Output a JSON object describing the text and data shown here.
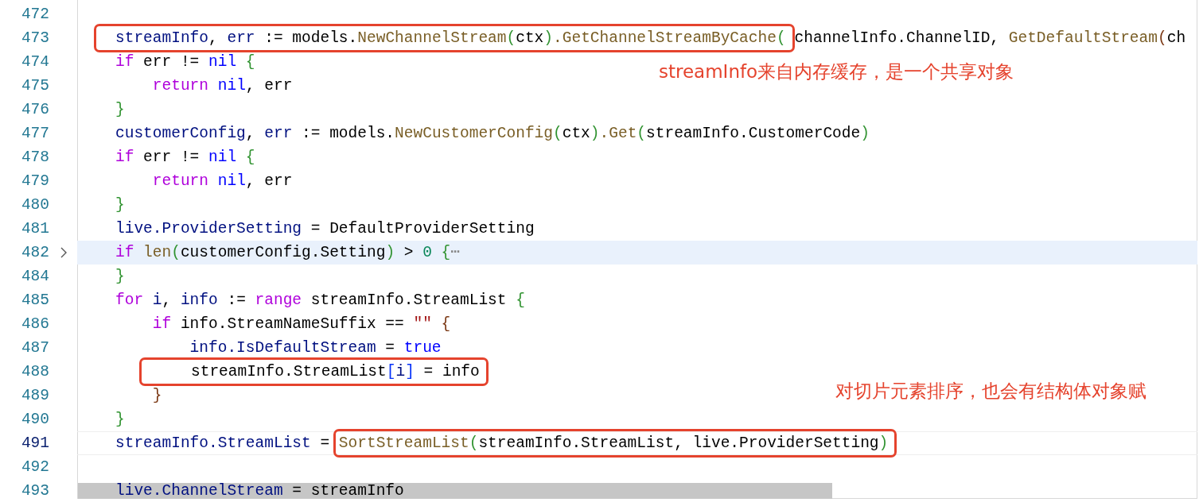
{
  "editor": {
    "lines": [
      {
        "number": "472"
      },
      {
        "number": "473",
        "box": [
          {
            "text": "streamInfo",
            "kind": "var"
          },
          {
            "text": ", ",
            "kind": "plain"
          },
          {
            "text": "err",
            "kind": "var"
          },
          {
            "text": " := models.",
            "kind": "plain"
          },
          {
            "text": "NewChannelStream",
            "kind": "fn"
          },
          {
            "text": "(",
            "kind": "bracket2"
          },
          {
            "text": "ctx",
            "kind": "plain"
          },
          {
            "text": ")",
            "kind": "bracket2"
          },
          {
            "text": ".GetChannelStreamByCache",
            "kind": "fn"
          },
          {
            "text": "(",
            "kind": "bracket2"
          }
        ],
        "after": [
          {
            "text": "channelInfo.ChannelID, ",
            "kind": "plain"
          },
          {
            "text": "GetDefaultStream",
            "kind": "fn"
          },
          {
            "text": "(",
            "kind": "bracket3"
          },
          {
            "text": "ch",
            "kind": "plain"
          }
        ]
      },
      {
        "number": "474",
        "tokens": [
          {
            "text": "if",
            "kind": "keyword"
          },
          {
            "text": " err != ",
            "kind": "plain"
          },
          {
            "text": "nil",
            "kind": "constant"
          },
          {
            "text": " {",
            "kind": "bracket2"
          }
        ],
        "note": "streamInfo来自内存缓存，是一个共享对象"
      },
      {
        "number": "475",
        "tokens": [
          {
            "text": "    return",
            "kind": "keyword"
          },
          {
            "text": " nil",
            "kind": "constant"
          },
          {
            "text": ", err",
            "kind": "plain"
          }
        ]
      },
      {
        "number": "476",
        "tokens": [
          {
            "text": "}",
            "kind": "bracket2"
          }
        ]
      },
      {
        "number": "477",
        "tokens": [
          {
            "text": "customerConfig",
            "kind": "var"
          },
          {
            "text": ", ",
            "kind": "plain"
          },
          {
            "text": "err",
            "kind": "var"
          },
          {
            "text": " := models.",
            "kind": "plain"
          },
          {
            "text": "NewCustomerConfig",
            "kind": "fn"
          },
          {
            "text": "(",
            "kind": "bracket2"
          },
          {
            "text": "ctx",
            "kind": "plain"
          },
          {
            "text": ")",
            "kind": "bracket2"
          },
          {
            "text": ".Get",
            "kind": "fn"
          },
          {
            "text": "(",
            "kind": "bracket2"
          },
          {
            "text": "streamInfo.CustomerCode",
            "kind": "plain"
          },
          {
            "text": ")",
            "kind": "bracket2"
          }
        ]
      },
      {
        "number": "478",
        "tokens": [
          {
            "text": "if",
            "kind": "keyword"
          },
          {
            "text": " err != ",
            "kind": "plain"
          },
          {
            "text": "nil",
            "kind": "constant"
          },
          {
            "text": " {",
            "kind": "bracket2"
          }
        ]
      },
      {
        "number": "479",
        "tokens": [
          {
            "text": "    return",
            "kind": "keyword"
          },
          {
            "text": " nil",
            "kind": "constant"
          },
          {
            "text": ", err",
            "kind": "plain"
          }
        ]
      },
      {
        "number": "480",
        "tokens": [
          {
            "text": "}",
            "kind": "bracket2"
          }
        ]
      },
      {
        "number": "481",
        "tokens": [
          {
            "text": "live.ProviderSetting",
            "kind": "var"
          },
          {
            "text": " = DefaultProviderSetting",
            "kind": "plain"
          }
        ]
      },
      {
        "number": "482",
        "highlighted": true,
        "folded": true,
        "tokens": [
          {
            "text": "if",
            "kind": "keyword"
          },
          {
            "text": " len",
            "kind": "fn"
          },
          {
            "text": "(",
            "kind": "bracket2"
          },
          {
            "text": "customerConfig.Setting",
            "kind": "plain"
          },
          {
            "text": ")",
            "kind": "bracket2"
          },
          {
            "text": " > ",
            "kind": "plain"
          },
          {
            "text": "0",
            "kind": "number"
          },
          {
            "text": " {",
            "kind": "bracket2"
          },
          {
            "text": "⋯",
            "kind": "ellipsis"
          }
        ]
      },
      {
        "number": "484",
        "tokens": [
          {
            "text": "}",
            "kind": "bracket2"
          }
        ]
      },
      {
        "number": "485",
        "tokens": [
          {
            "text": "for",
            "kind": "keyword"
          },
          {
            "text": " i",
            "kind": "var"
          },
          {
            "text": ", ",
            "kind": "plain"
          },
          {
            "text": "info",
            "kind": "var"
          },
          {
            "text": " := ",
            "kind": "plain"
          },
          {
            "text": "range",
            "kind": "keyword"
          },
          {
            "text": " streamInfo.StreamList ",
            "kind": "plain"
          },
          {
            "text": "{",
            "kind": "bracket2"
          }
        ]
      },
      {
        "number": "486",
        "tokens": [
          {
            "text": "    if",
            "kind": "keyword"
          },
          {
            "text": " info.StreamNameSuffix == ",
            "kind": "plain"
          },
          {
            "text": "\"\"",
            "kind": "string"
          },
          {
            "text": " {",
            "kind": "bracket3"
          }
        ]
      },
      {
        "number": "487",
        "tokens": [
          {
            "text": "        info.IsDefaultStream",
            "kind": "var"
          },
          {
            "text": " = ",
            "kind": "plain"
          },
          {
            "text": "true",
            "kind": "constant"
          }
        ]
      },
      {
        "number": "488",
        "box": [
          {
            "text": "streamInfo.StreamList",
            "kind": "plain"
          },
          {
            "text": "[",
            "kind": "bracket1"
          },
          {
            "text": "i",
            "kind": "var"
          },
          {
            "text": "]",
            "kind": "bracket1"
          },
          {
            "text": " = info",
            "kind": "plain"
          }
        ]
      },
      {
        "number": "489",
        "tokens": [
          {
            "text": "    }",
            "kind": "bracket3"
          }
        ],
        "note": "对切片元素排序，也会有结构体对象赋"
      },
      {
        "number": "490",
        "tokens": [
          {
            "text": "}",
            "kind": "bracket2"
          }
        ]
      },
      {
        "number": "491",
        "current": true,
        "tokens": [
          {
            "text": "streamInfo.StreamList",
            "kind": "var"
          },
          {
            "text": " = ",
            "kind": "plain"
          }
        ],
        "box": [
          {
            "text": "SortStreamList",
            "kind": "fn"
          },
          {
            "text": "(",
            "kind": "bracket2"
          },
          {
            "text": "streamInfo.StreamList, live.ProviderSetting",
            "kind": "plain"
          },
          {
            "text": ")",
            "kind": "bracket2"
          }
        ]
      },
      {
        "number": "492"
      },
      {
        "number": "493",
        "tokens": [
          {
            "text": "live.ChannelStream",
            "kind": "var"
          },
          {
            "text": " = streamInfo",
            "kind": "plain"
          }
        ]
      }
    ]
  }
}
